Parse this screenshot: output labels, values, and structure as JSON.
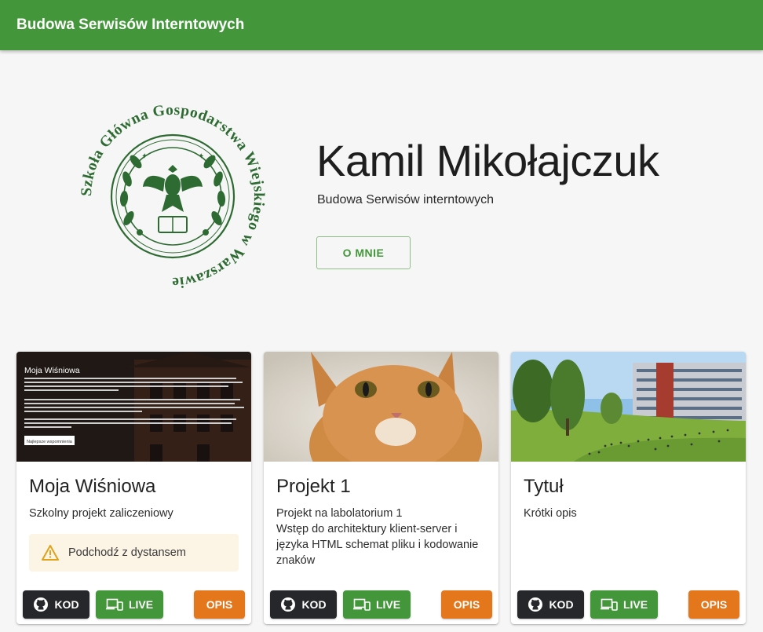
{
  "appbar": {
    "title": "Budowa Serwisów Interntowych"
  },
  "hero": {
    "logo_text": "Szkoła Główna Gospodarstwa Wiejskiego w Warszawie",
    "name": "Kamil Mikołajczuk",
    "subtitle": "Budowa Serwisów interntowych",
    "about_button": "O MNIE"
  },
  "colors": {
    "primary": "#43973a",
    "dark": "#25272a",
    "accent": "#e4761b",
    "warning_bg": "#fcf4e4",
    "warning_icon": "#e0a21a"
  },
  "cards": [
    {
      "title": "Moja Wiśniowa",
      "lines": [
        "Szkolny projekt zaliczeniowy"
      ],
      "thumb": {
        "heading": "Moja Wiśniowa",
        "button": "Najlepsze wspomnienia"
      },
      "alert": {
        "icon": "warning-icon",
        "text": "Podchodź z dystansem"
      },
      "buttons": {
        "code": "KOD",
        "live": "LIVE",
        "desc": "OPIS"
      }
    },
    {
      "title": "Projekt 1",
      "lines": [
        "Projekt na labolatorium 1",
        "Wstęp do architektury klient-server i",
        "języka HTML schemat pliku i kodowanie",
        "znaków"
      ],
      "buttons": {
        "code": "KOD",
        "live": "LIVE",
        "desc": "OPIS"
      }
    },
    {
      "title": "Tytuł",
      "lines": [
        "Krótki opis"
      ],
      "buttons": {
        "code": "KOD",
        "live": "LIVE",
        "desc": "OPIS"
      }
    }
  ],
  "icons": {
    "code": "github-icon",
    "live": "devices-icon",
    "alert": "warning-icon"
  }
}
